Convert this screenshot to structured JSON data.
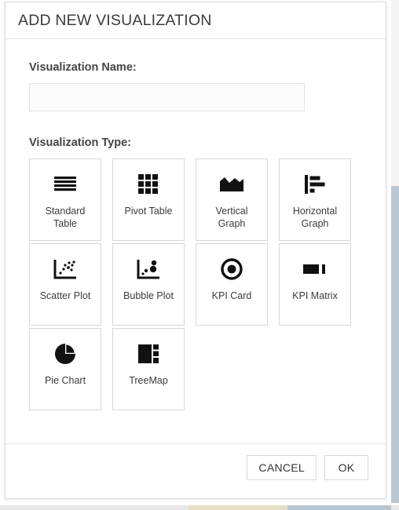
{
  "dialog": {
    "title": "ADD NEW VISUALIZATION",
    "name_field": {
      "label": "Visualization Name:",
      "value": "",
      "placeholder": ""
    },
    "type_field": {
      "label": "Visualization Type:",
      "options": [
        {
          "label": "Standard\nTable",
          "icon": "standard-table-icon"
        },
        {
          "label": "Pivot Table",
          "icon": "pivot-table-icon"
        },
        {
          "label": "Vertical\nGraph",
          "icon": "vertical-graph-icon"
        },
        {
          "label": "Horizontal\nGraph",
          "icon": "horizontal-graph-icon"
        },
        {
          "label": "Scatter Plot",
          "icon": "scatter-plot-icon"
        },
        {
          "label": "Bubble Plot",
          "icon": "bubble-plot-icon"
        },
        {
          "label": "KPI Card",
          "icon": "kpi-card-icon"
        },
        {
          "label": "KPI Matrix",
          "icon": "kpi-matrix-icon"
        },
        {
          "label": "Pie Chart",
          "icon": "pie-chart-icon"
        },
        {
          "label": "TreeMap",
          "icon": "treemap-icon"
        }
      ]
    },
    "footer": {
      "cancel_label": "CANCEL",
      "ok_label": "OK"
    }
  },
  "colors": {
    "dialog_border": "#dddddd",
    "title_text": "#3c3c3c",
    "tile_border": "#d6d6d6",
    "icon_fill": "#111111",
    "scrollbar": "#b9c7d2",
    "bottom_beige": "#e6dfc4"
  }
}
